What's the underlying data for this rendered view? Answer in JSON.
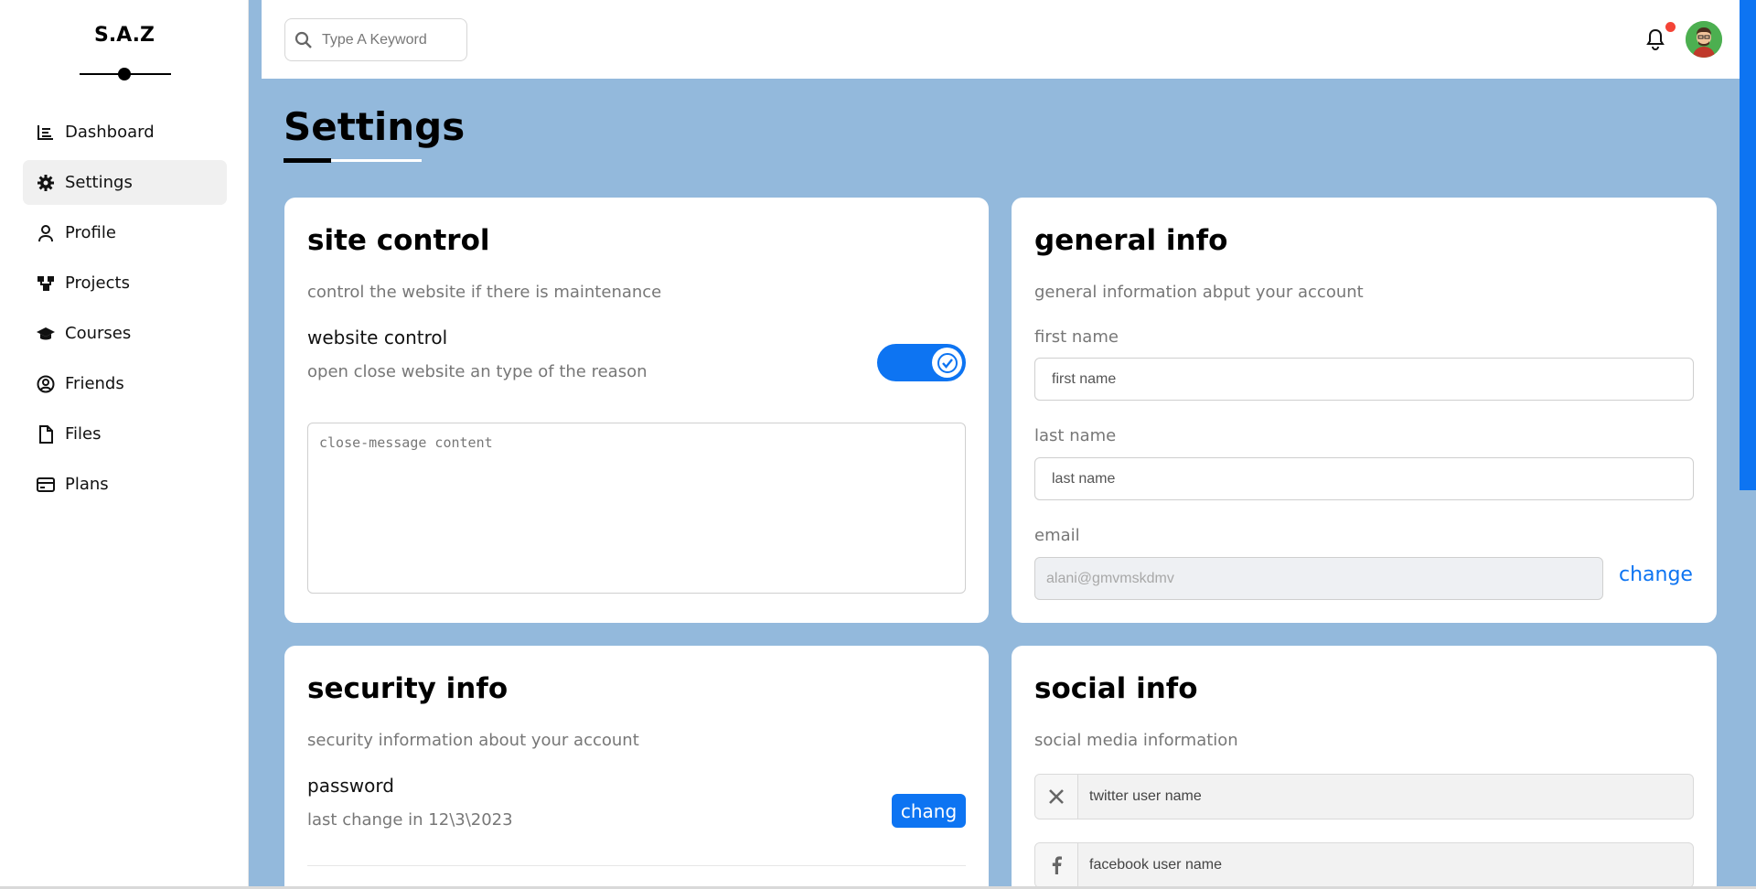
{
  "brand": {
    "name": "S.A.Z"
  },
  "sidebar": {
    "items": [
      {
        "label": "Dashboard",
        "icon": "chart-icon"
      },
      {
        "label": "Settings",
        "icon": "gear-icon",
        "active": true
      },
      {
        "label": "Profile",
        "icon": "user-icon"
      },
      {
        "label": "Projects",
        "icon": "diagram-icon"
      },
      {
        "label": "Courses",
        "icon": "graduation-cap-icon"
      },
      {
        "label": "Friends",
        "icon": "user-circle-icon"
      },
      {
        "label": "Files",
        "icon": "file-icon"
      },
      {
        "label": "Plans",
        "icon": "credit-card-icon"
      }
    ]
  },
  "topbar": {
    "search_placeholder": "Type A Keyword",
    "notification_dot_color": "#f44336"
  },
  "page": {
    "title": "Settings"
  },
  "site_control": {
    "title": "site control",
    "subtitle": "control the website if there is maintenance",
    "website_control_label": "website control",
    "website_control_desc": "open close website an type of the reason",
    "toggle_on": true,
    "message_placeholder": "close-message content"
  },
  "general_info": {
    "title": "general info",
    "subtitle": "general information abput your account",
    "first_name_label": "first name",
    "first_name_placeholder": "first name",
    "last_name_label": "last name",
    "last_name_placeholder": "last name",
    "email_label": "email",
    "email_value": "alani@gmvmskdmv",
    "change_label": "change"
  },
  "security_info": {
    "title": "security info",
    "subtitle": "security information about your account",
    "password_label": "password",
    "password_last_change": "last change in 12\\3\\2023",
    "change_button": "chang"
  },
  "social_info": {
    "title": "social info",
    "subtitle": "social media information",
    "twitter_placeholder": "twitter user name",
    "facebook_placeholder": "facebook user name"
  },
  "colors": {
    "accent": "#0d74f2",
    "background": "#93b9dc"
  }
}
